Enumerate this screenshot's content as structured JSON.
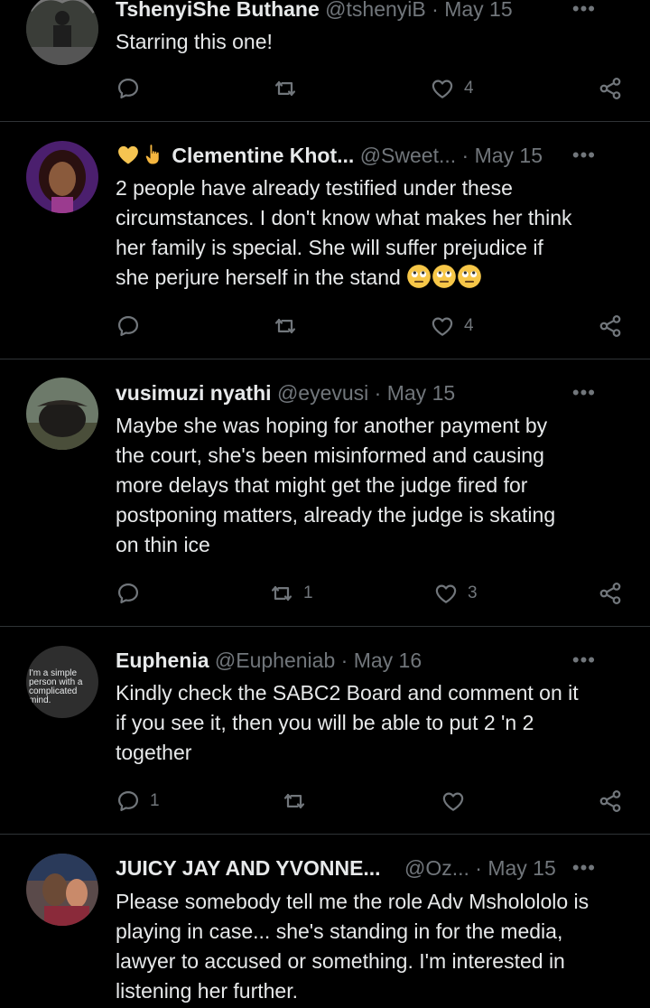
{
  "tweets": [
    {
      "name": "TshenyiShe Buthane",
      "handle": "@tshenyiB",
      "sep": "·",
      "date": "May 15",
      "text": "Starring this one!",
      "more": "•••",
      "replies": "",
      "retweets": "",
      "likes": "4"
    },
    {
      "name": "Clementine Khot...",
      "handle": "@Sweet...",
      "sep": "·",
      "date": "May 15",
      "text_lines": [
        "2 people have already testified under these",
        "circumstances. I don't know what makes her think",
        "her family is special. She will suffer prejudice if",
        "she perjure herself in the stand"
      ],
      "more": "•••",
      "replies": "",
      "retweets": "",
      "likes": "4"
    },
    {
      "name": "vusimuzi nyathi",
      "handle": "@eyevusi",
      "sep": "·",
      "date": "May 15",
      "text_lines": [
        "Maybe she was hoping for another payment by",
        "the court, she's been misinformed and causing",
        "more delays that might get the judge fired for",
        "postponing matters, already the judge is skating",
        "on thin ice"
      ],
      "more": "•••",
      "replies": "",
      "retweets": "1",
      "likes": "3"
    },
    {
      "name": "Euphenia",
      "handle": "@Eupheniab",
      "sep": "·",
      "date": "May 16",
      "avatar_text": [
        "I'm a simple",
        "person with a",
        "complicated",
        "mind."
      ],
      "text_lines": [
        "Kindly check the SABC2 Board and comment on it",
        "if you see it, then you will be able to put 2 'n 2",
        "together"
      ],
      "more": "•••",
      "replies": "1",
      "retweets": "",
      "likes": ""
    },
    {
      "name": "JUICY JAY AND YVONNE...",
      "handle": "@Oz...",
      "sep": "·",
      "date": "May 15",
      "text_lines": [
        "Please somebody tell me the role Adv Msholololo is",
        "playing in case... she's standing in for the media,",
        "lawyer to accused or something. I'm interested in",
        "listening her further."
      ],
      "more": "•••",
      "replies": "",
      "retweets": "",
      "likes": ""
    }
  ],
  "colors": {
    "background": "#000000",
    "text": "#e7e9ea",
    "muted": "#71767b",
    "divider": "#2f3336"
  }
}
